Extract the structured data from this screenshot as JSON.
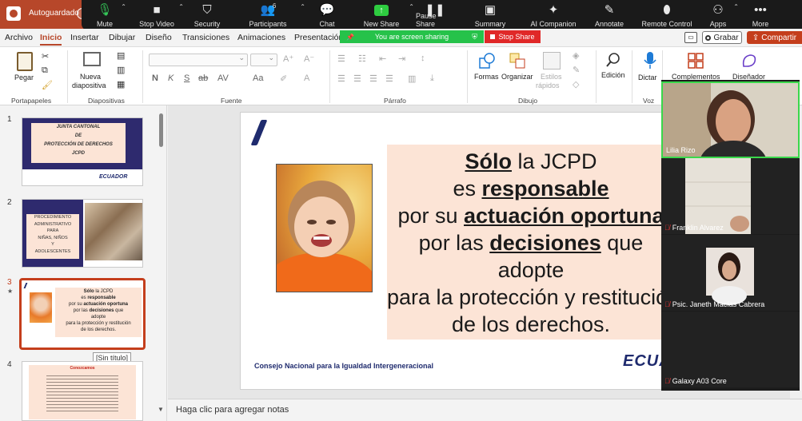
{
  "titlebar": {
    "autosave_label": "Autoguardado"
  },
  "zoom_toolbar": {
    "items": [
      {
        "label": "Mute",
        "icon": "microphone-icon"
      },
      {
        "label": "Stop Video",
        "icon": "camera-icon"
      },
      {
        "label": "Security",
        "icon": "shield-icon"
      },
      {
        "label": "Participants",
        "icon": "people-icon",
        "count": "6"
      },
      {
        "label": "Chat",
        "icon": "chat-icon"
      },
      {
        "label": "New Share",
        "icon": "share-arrow-icon"
      },
      {
        "label": "Pause Share",
        "icon": "pause-icon"
      },
      {
        "label": "Summary",
        "icon": "summary-icon"
      },
      {
        "label": "AI Companion",
        "icon": "sparkle-icon"
      },
      {
        "label": "Annotate",
        "icon": "pen-icon"
      },
      {
        "label": "Remote Control",
        "icon": "mouse-icon"
      },
      {
        "label": "Apps",
        "icon": "apps-icon"
      },
      {
        "label": "More",
        "icon": "more-dots-icon"
      }
    ],
    "sharing_banner": "You are screen sharing",
    "stop_share": "Stop Share"
  },
  "ribbon_tabs": [
    "Archivo",
    "Inicio",
    "Insertar",
    "Dibujar",
    "Diseño",
    "Transiciones",
    "Animaciones",
    "Presentación"
  ],
  "ribbon_right": {
    "grabar": "Grabar",
    "compartir": "Compartir"
  },
  "ribbon": {
    "groups": {
      "portapapeles": "Portapapeles",
      "diapositivas": "Diapositivas",
      "fuente": "Fuente",
      "parrafo": "Párrafo",
      "dibujo": "Dibujo",
      "voz": "Voz"
    },
    "buttons": {
      "pegar": "Pegar",
      "nueva": "Nueva",
      "diapositiva": "diapositiva",
      "formas": "Formas",
      "organizar": "Organizar",
      "estilos": "Estilos",
      "rapidos": "rápidos",
      "edicion": "Edición",
      "dictar": "Dictar",
      "complementos": "Complementos",
      "disenador": "Diseñador"
    },
    "format_letters": [
      "N",
      "K",
      "S",
      "ab",
      "AV",
      "Aa"
    ]
  },
  "thumbnails": {
    "numbers": [
      "1",
      "2",
      "3",
      "4"
    ],
    "current_marker": "★",
    "t1_lines": [
      "JUNTA CANTONAL",
      "DE",
      "PROTECCIÓN DE DERECHOS",
      "JCPD"
    ],
    "t2_lines": [
      "PROCEDIMIENTO",
      "ADMINISTRATIVO",
      "PARA",
      "NIÑAS, NIÑOS",
      "Y",
      "ADOLESCENTES"
    ],
    "t4_title": "Conozcamos",
    "tooltip": "[Sin título]",
    "ecuador_small": "ECUADOR"
  },
  "slide": {
    "lines": [
      {
        "parts": [
          {
            "t": "Sólo",
            "b": true
          },
          {
            "t": " la JCPD",
            "b": false
          }
        ]
      },
      {
        "parts": [
          {
            "t": "es ",
            "b": false
          },
          {
            "t": "responsable",
            "b": true
          }
        ]
      },
      {
        "parts": [
          {
            "t": "por su ",
            "b": false
          },
          {
            "t": "actuación oportuna",
            "b": true
          }
        ]
      },
      {
        "parts": [
          {
            "t": "por las ",
            "b": false
          },
          {
            "t": "decisiones",
            "b": true
          },
          {
            "t": " que",
            "b": false
          }
        ]
      },
      {
        "parts": [
          {
            "t": "adopte",
            "b": false
          }
        ]
      },
      {
        "parts": [
          {
            "t": "para la protección y restitución",
            "b": false
          }
        ]
      },
      {
        "parts": [
          {
            "t": "de los derechos.",
            "b": false
          }
        ]
      }
    ],
    "footer": "Consejo Nacional para la Igualdad Intergeneracional",
    "logo": "ECUADOR"
  },
  "notes": {
    "label": "Haga clic para agregar notas"
  },
  "participants": [
    {
      "name": "Lilia Rizo",
      "muted": false
    },
    {
      "name": "Franklin Alvarez",
      "muted": true
    },
    {
      "name": "Psic. Janeth Macías Cabrera",
      "muted": true
    },
    {
      "name": "Galaxy A03 Core",
      "muted": true
    }
  ],
  "colors": {
    "accent": "#c43e1c",
    "zoom_bg": "#1a1a1a",
    "share_green": "#26c24a",
    "stop_red": "#e02828",
    "slide_box": "#fce4d6",
    "navy": "#1f2b6e"
  }
}
